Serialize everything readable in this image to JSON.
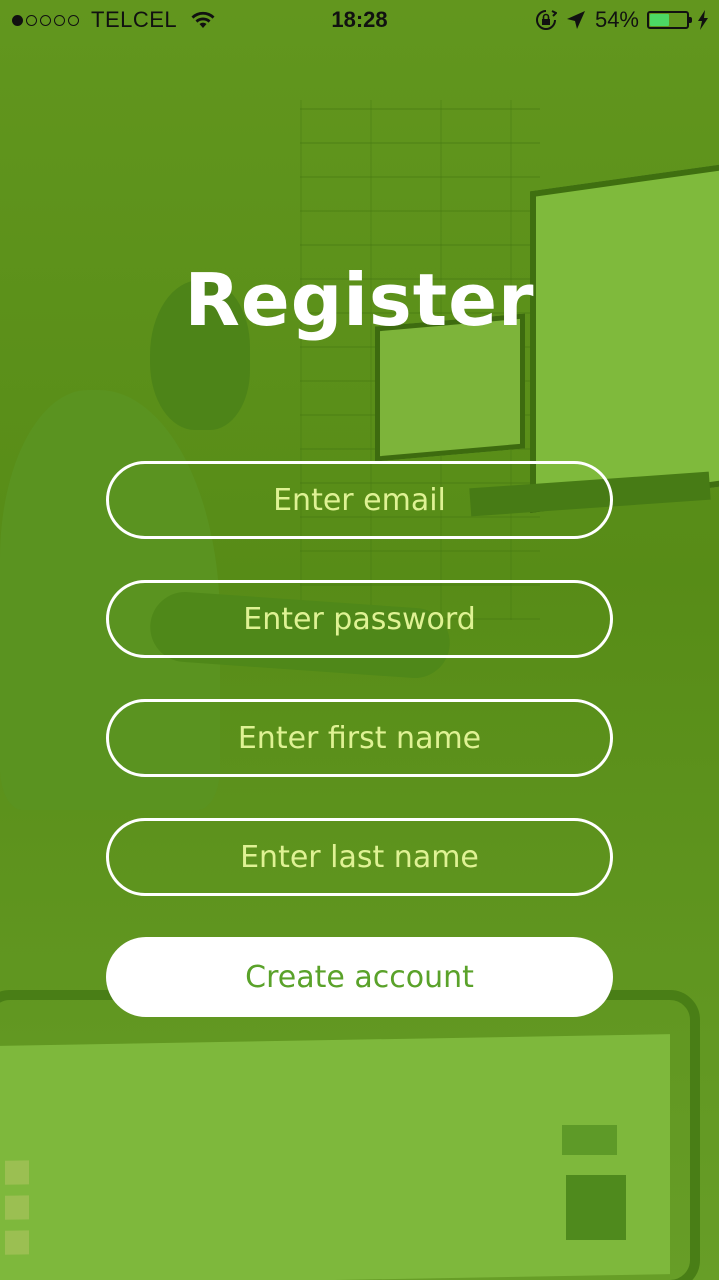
{
  "status_bar": {
    "carrier": "TELCEL",
    "time": "18:28",
    "battery_percent": "54%",
    "battery_level": 0.54,
    "signal_bars_filled": 1,
    "signal_bars_total": 5,
    "icons": [
      "wifi-icon",
      "orientation-lock-icon",
      "location-arrow-icon",
      "battery-icon",
      "charging-bolt-icon"
    ]
  },
  "form": {
    "title": "Register",
    "email_placeholder": "Enter email",
    "password_placeholder": "Enter password",
    "first_name_placeholder": "Enter first name",
    "last_name_placeholder": "Enter last name",
    "submit_label": "Create account"
  },
  "colors": {
    "background_overlay": "#5f9a1e",
    "button_text": "#5aa22a",
    "placeholder_text": "#dff294",
    "battery_fill": "#4cd964"
  }
}
